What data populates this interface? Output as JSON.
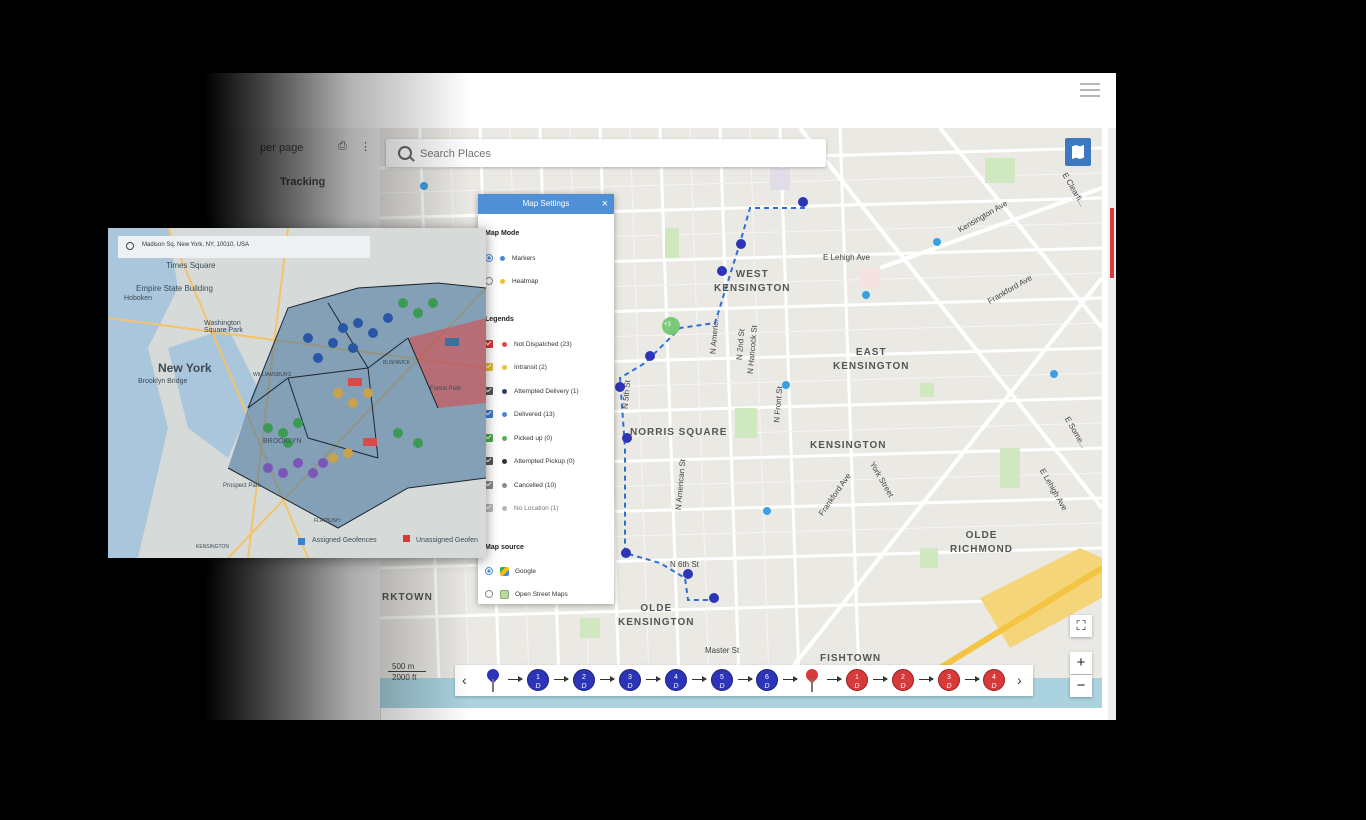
{
  "app": {
    "menu_icon": "hamburger-menu-icon"
  },
  "left_pane": {
    "per_page": "per page",
    "tracking": "Tracking"
  },
  "search": {
    "placeholder": "Search Places"
  },
  "map_labels": [
    {
      "name": "west-kensington",
      "text": "WEST\nKENSINGTON"
    },
    {
      "name": "east-kensington",
      "text": "EAST\nKENSINGTON"
    },
    {
      "name": "norris-square",
      "text": "NORRIS SQUARE"
    },
    {
      "name": "kensington",
      "text": "KENSINGTON"
    },
    {
      "name": "olde-richmond",
      "text": "OLDE\nRICHMOND"
    },
    {
      "name": "olde-kensington",
      "text": "OLDE\nKENSINGTON"
    },
    {
      "name": "fishtown",
      "text": "FISHTOWN"
    },
    {
      "name": "rktown",
      "text": "RKTOWN"
    }
  ],
  "streets": {
    "e_lehigh": "E Lehigh Ave",
    "kensington_ave": "Kensington Ave",
    "frankford_ave": "Frankford Ave",
    "frankford_ave2": "Frankford Ave",
    "n_front": "N Front St",
    "n_2nd": "N 2nd St",
    "n_hancock": "N Hancock St",
    "n_american": "N American St",
    "york": "York Street",
    "e_lehigh2": "E Lehigh Ave",
    "e_clearfield": "E Clearfi...",
    "e_somerset": "E Some...",
    "master": "Master St",
    "n_5th": "N 5th St",
    "n_american2": "N Americ...",
    "n_6th": "N 6th St"
  },
  "map_settings": {
    "title": "Map Settings",
    "close": "×",
    "map_mode_label": "Map Mode",
    "modes": [
      {
        "label": "Markers",
        "selected": true
      },
      {
        "label": "Heatmap",
        "selected": false
      }
    ],
    "legends_label": "Legends",
    "legends": [
      {
        "label": "Not Dispatched (23)",
        "color": "#e04646",
        "box": "#d63a3a"
      },
      {
        "label": "Intransit (2)",
        "color": "#e9c13a",
        "box": "#e8b732"
      },
      {
        "label": "Attempted Delivery (1)",
        "color": "#2e3f66",
        "box": "#555"
      },
      {
        "label": "Delivered (13)",
        "color": "#4a86d4",
        "box": "#3b7fd1"
      },
      {
        "label": "Picked up (0)",
        "color": "#54b14a",
        "box": "#4cae4c"
      },
      {
        "label": "Attempted Pickup (0)",
        "color": "#333",
        "box": "#555"
      },
      {
        "label": "Cancelled (10)",
        "color": "#8b8b8b",
        "box": "#8b8b8b"
      },
      {
        "label": "No Location (1)",
        "color": "#b5b5b5",
        "box": "#b8b8b8"
      }
    ],
    "source_label": "Map source",
    "sources": [
      {
        "label": "Google",
        "selected": true,
        "icon": "google-maps-icon"
      },
      {
        "label": "Open Street Maps",
        "selected": false,
        "icon": "osm-icon"
      }
    ]
  },
  "controls": {
    "fullscreen": "⛶",
    "zoom_in": "+",
    "zoom_out": "−"
  },
  "scale": {
    "metric": "500 m",
    "imperial": "2000 ft"
  },
  "route": {
    "prev": "‹",
    "next": "›",
    "stops": [
      {
        "kind": "pin",
        "color": "#2c34b7"
      },
      {
        "kind": "stop",
        "color": "b",
        "num": "1",
        "sub": "D"
      },
      {
        "kind": "stop",
        "color": "b",
        "num": "2",
        "sub": "D"
      },
      {
        "kind": "stop",
        "color": "b",
        "num": "3",
        "sub": "D"
      },
      {
        "kind": "stop",
        "color": "b",
        "num": "4",
        "sub": "D"
      },
      {
        "kind": "stop",
        "color": "b",
        "num": "5",
        "sub": "D"
      },
      {
        "kind": "stop",
        "color": "b",
        "num": "6",
        "sub": "D"
      },
      {
        "kind": "pin",
        "color": "#d63a3a"
      },
      {
        "kind": "stop",
        "color": "r",
        "num": "1",
        "sub": "D"
      },
      {
        "kind": "stop",
        "color": "r",
        "num": "2",
        "sub": "D"
      },
      {
        "kind": "stop",
        "color": "r",
        "num": "3",
        "sub": "D"
      },
      {
        "kind": "stop",
        "color": "r",
        "num": "4",
        "sub": "D"
      }
    ]
  },
  "cluster": {
    "count": "+3"
  },
  "overlay": {
    "search_text": "Madison Sq. New York, NY, 10010, USA",
    "labels": {
      "times_square": "Times Square",
      "esb": "Empire State Building",
      "hoboken": "Hoboken",
      "washington_sq": "Washington\nSquare Park",
      "new_york": "New York",
      "brooklyn_bridge": "Brooklyn Bridge",
      "williamsburg": "WILLIAMSBURG",
      "bushwick": "BUSHWICK",
      "forest_park": "Forest Park",
      "flatbush": "FLATBUSH",
      "kensington": "KENSINGTON",
      "brooklyn": "BROOKLYN",
      "prospect": "Prospect Park"
    },
    "assigned": "Assigned Geofences",
    "unassigned": "Unassigned Geofen"
  }
}
